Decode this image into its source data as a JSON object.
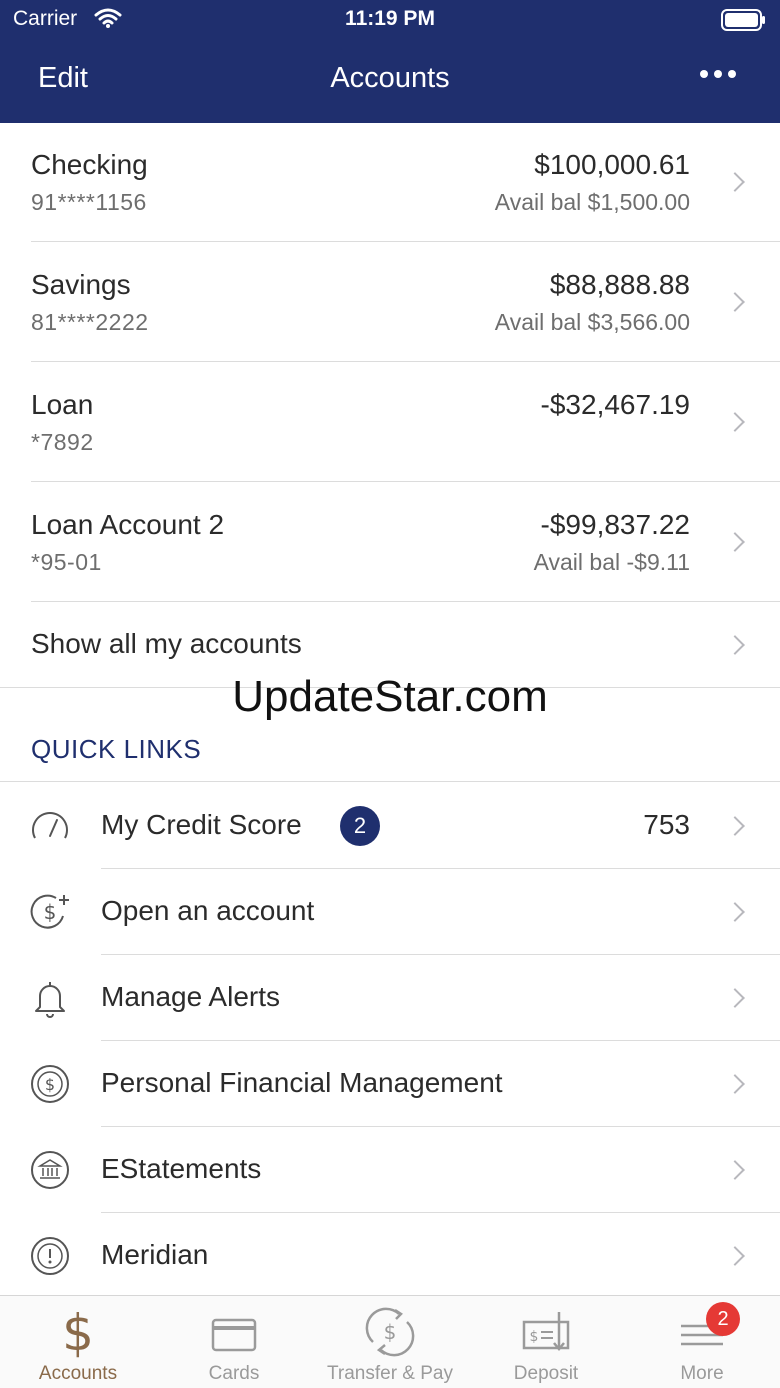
{
  "status_bar": {
    "carrier": "Carrier",
    "time": "11:19 PM"
  },
  "nav": {
    "edit_label": "Edit",
    "title": "Accounts",
    "more_icon": "ellipsis-icon"
  },
  "accounts": [
    {
      "name": "Checking",
      "number": "91****1156",
      "balance": "$100,000.61",
      "avail": "Avail bal $1,500.00"
    },
    {
      "name": "Savings",
      "number": "81****2222",
      "balance": "$88,888.88",
      "avail": "Avail bal $3,566.00"
    },
    {
      "name": "Loan",
      "number": "*7892",
      "balance": "-$32,467.19",
      "avail": ""
    },
    {
      "name": "Loan Account 2",
      "number": "*95-01",
      "balance": "-$99,837.22",
      "avail": "Avail bal -$9.11"
    }
  ],
  "show_all_label": "Show all my accounts",
  "watermark": "UpdateStar.com",
  "quick_links": {
    "title": "QUICK LINKS",
    "items": [
      {
        "label": "My Credit Score",
        "icon": "gauge-icon",
        "badge": "2",
        "value": "753"
      },
      {
        "label": "Open an account",
        "icon": "dollar-plus-icon"
      },
      {
        "label": "Manage Alerts",
        "icon": "bell-icon"
      },
      {
        "label": "Personal Financial Management",
        "icon": "dollar-circle-icon"
      },
      {
        "label": "EStatements",
        "icon": "bank-icon"
      },
      {
        "label": "Meridian",
        "icon": "info-circle-icon"
      }
    ]
  },
  "tab_bar": {
    "tabs": [
      {
        "label": "Accounts",
        "icon": "dollar-icon",
        "active": true
      },
      {
        "label": "Cards",
        "icon": "card-icon"
      },
      {
        "label": "Transfer & Pay",
        "icon": "transfer-icon"
      },
      {
        "label": "Deposit",
        "icon": "check-deposit-icon"
      },
      {
        "label": "More",
        "icon": "menu-icon",
        "badge": "2"
      }
    ]
  },
  "colors": {
    "brand": "#1f2f6e",
    "active_tab": "#8a6a4a",
    "badge_red": "#e53935"
  }
}
